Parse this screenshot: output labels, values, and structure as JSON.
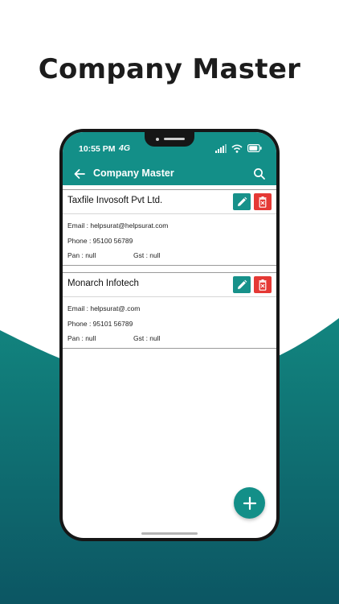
{
  "promo": {
    "headline": "Company Master"
  },
  "status_bar": {
    "time": "10:55 PM",
    "network": "4G",
    "icons": [
      "signal-icon",
      "wifi-icon",
      "battery-icon"
    ]
  },
  "app_bar": {
    "title": "Company Master",
    "back_icon": "arrow-back-icon",
    "search_icon": "search-icon"
  },
  "companies": [
    {
      "name": "Taxfile Invosoft Pvt Ltd.",
      "email": "Email : helpsurat@helpsurat.com",
      "phone": "Phone : 95100 56789",
      "pan": "Pan : null",
      "gst": "Gst : null"
    },
    {
      "name": "Monarch Infotech",
      "email": "Email : helpsurat@.com",
      "phone": "Phone : 95101 56789",
      "pan": "Pan : null",
      "gst": "Gst : null"
    }
  ],
  "colors": {
    "primary": "#138f88",
    "delete": "#e53935",
    "edit": "#17918a"
  }
}
